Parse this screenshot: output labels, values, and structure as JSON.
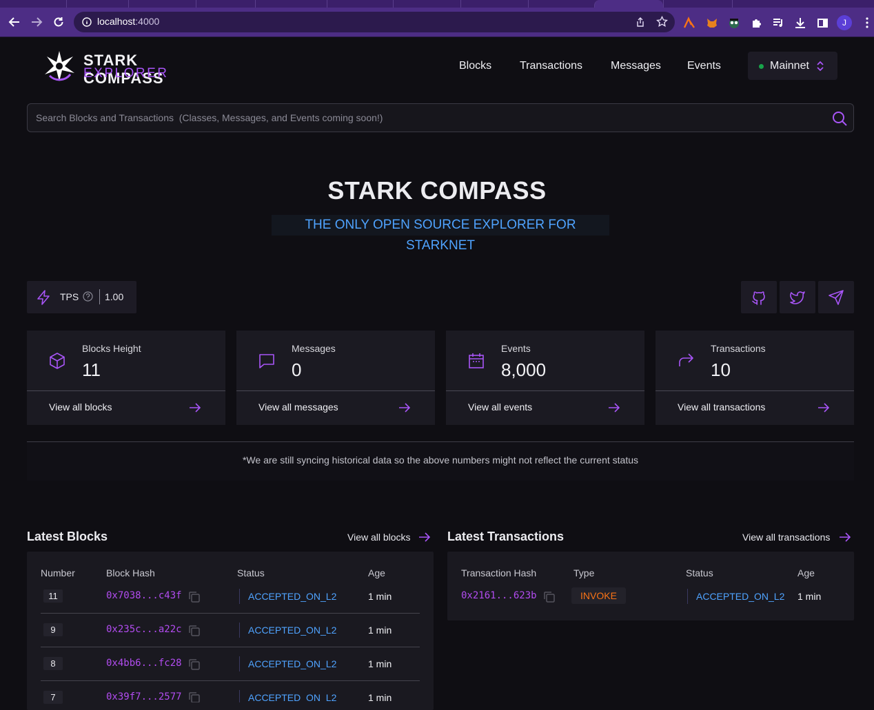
{
  "browser": {
    "url_host": "localhost",
    "url_port": ":4000",
    "profile_initial": "J"
  },
  "header": {
    "logo_title": "STARK COMPASS",
    "logo_subtitle": "EXPLORER",
    "nav": [
      "Blocks",
      "Transactions",
      "Messages",
      "Events"
    ],
    "network": "Mainnet"
  },
  "search": {
    "placeholder": "Search Blocks and Transactions  (Classes, Messages, and Events coming soon!)"
  },
  "hero": {
    "title": "STARK COMPASS",
    "subtitle": "THE ONLY OPEN SOURCE EXPLORER FOR STARKNET"
  },
  "tps": {
    "label": "TPS",
    "value": "1.00"
  },
  "cards": [
    {
      "label": "Blocks Height",
      "value": "11",
      "link": "View all blocks"
    },
    {
      "label": "Messages",
      "value": "0",
      "link": "View all messages"
    },
    {
      "label": "Events",
      "value": "8,000",
      "link": "View all events"
    },
    {
      "label": "Transactions",
      "value": "10",
      "link": "View all transactions"
    }
  ],
  "sync_notice": "*We are still syncing historical data so the above numbers might not reflect the current status",
  "latest_blocks": {
    "title": "Latest Blocks",
    "link": "View all blocks",
    "columns": [
      "Number",
      "Block Hash",
      "Status",
      "Age"
    ],
    "rows": [
      {
        "number": "11",
        "hash": "0x7038...c43f",
        "status": "ACCEPTED_ON_L2",
        "age": "1 min"
      },
      {
        "number": "9",
        "hash": "0x235c...a22c",
        "status": "ACCEPTED_ON_L2",
        "age": "1 min"
      },
      {
        "number": "8",
        "hash": "0x4bb6...fc28",
        "status": "ACCEPTED_ON_L2",
        "age": "1 min"
      },
      {
        "number": "7",
        "hash": "0x39f7...2577",
        "status": "ACCEPTED_ON_L2",
        "age": "1 min"
      }
    ]
  },
  "latest_transactions": {
    "title": "Latest Transactions",
    "link": "View all transactions",
    "columns": [
      "Transaction Hash",
      "Type",
      "Status",
      "Age"
    ],
    "rows": [
      {
        "hash": "0x2161...623b",
        "type": "INVOKE",
        "status": "ACCEPTED_ON_L2",
        "age": "1 min"
      }
    ]
  },
  "colors": {
    "accent_purple": "#a855f7",
    "link_blue": "#4fa3ff",
    "invoke_orange": "#f97316",
    "network_dot_green": "#18a34a"
  }
}
